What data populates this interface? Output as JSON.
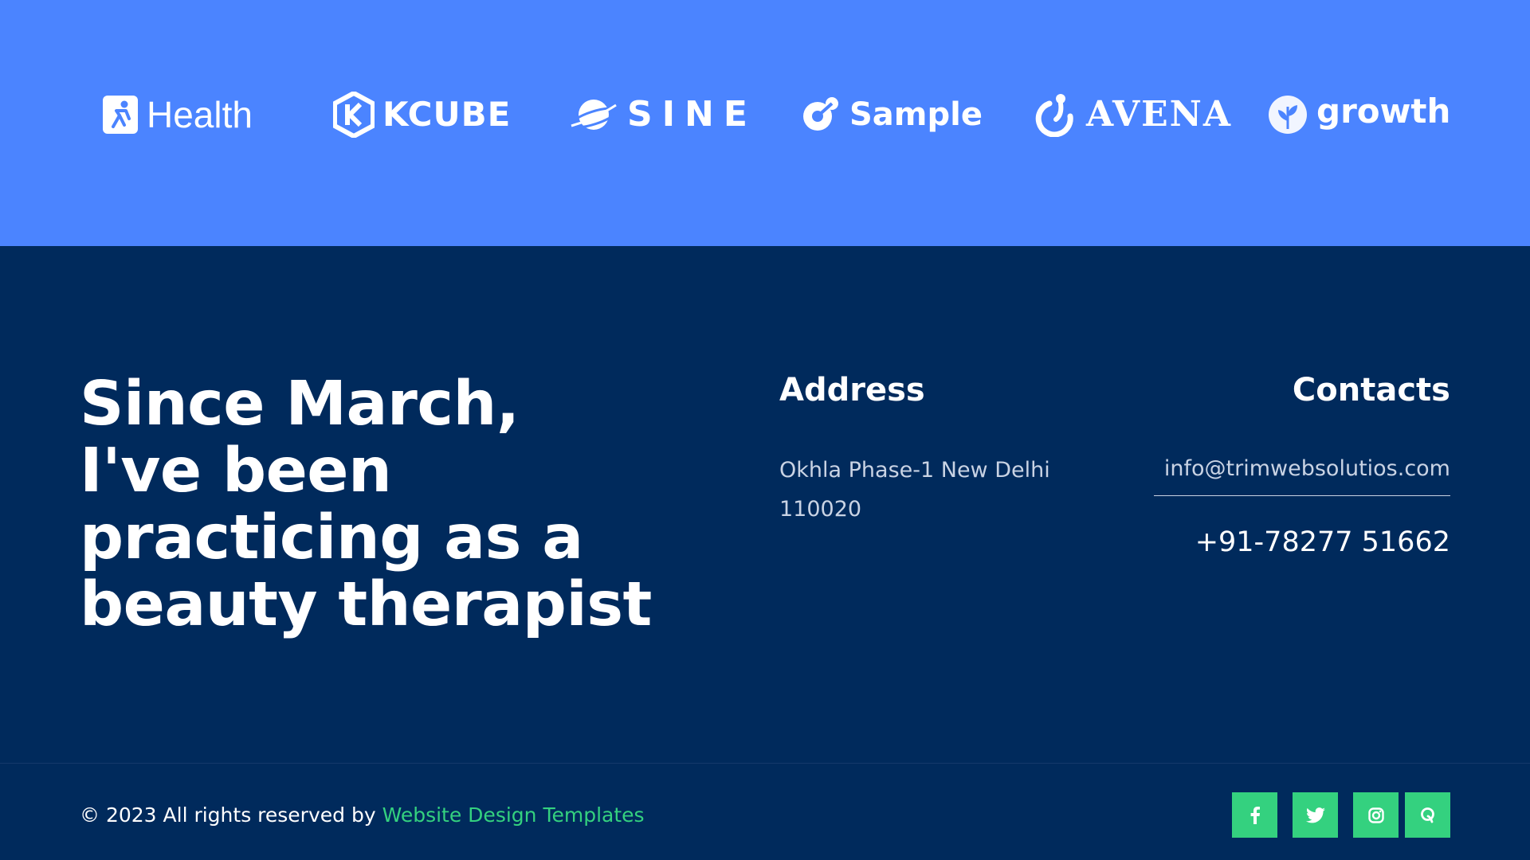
{
  "logos": [
    {
      "name": "Health",
      "icon": "health-icon"
    },
    {
      "name": "KCUBE",
      "icon": "kcube-icon"
    },
    {
      "name": "SINE",
      "icon": "planet-icon"
    },
    {
      "name": "Sample",
      "icon": "sample-icon"
    },
    {
      "name": "AVENA",
      "icon": "avena-icon"
    },
    {
      "name": "growth",
      "icon": "leaf-icon"
    }
  ],
  "footer": {
    "headline": "Since March, I've been practicing as a beauty therapist",
    "address": {
      "title": "Address",
      "text": "Okhla Phase-1 New Delhi 110020"
    },
    "contacts": {
      "title": "Contacts",
      "email": "info@trimwebsolutios.com",
      "phone": "+91-78277 51662"
    },
    "copyright": {
      "prefix": "© 2023 All rights reserved by ",
      "link": "Website Design Templates"
    },
    "social": [
      {
        "name": "facebook",
        "icon": "facebook-icon"
      },
      {
        "name": "twitter",
        "icon": "twitter-icon"
      },
      {
        "name": "instagram",
        "icon": "instagram-icon"
      },
      {
        "name": "quora",
        "icon": "quora-icon"
      }
    ]
  },
  "colors": {
    "logo_strip_bg": "#4b84ff",
    "footer_bg": "#002a5c",
    "accent_green": "#34d17f",
    "muted_text": "#c9d3e4"
  }
}
